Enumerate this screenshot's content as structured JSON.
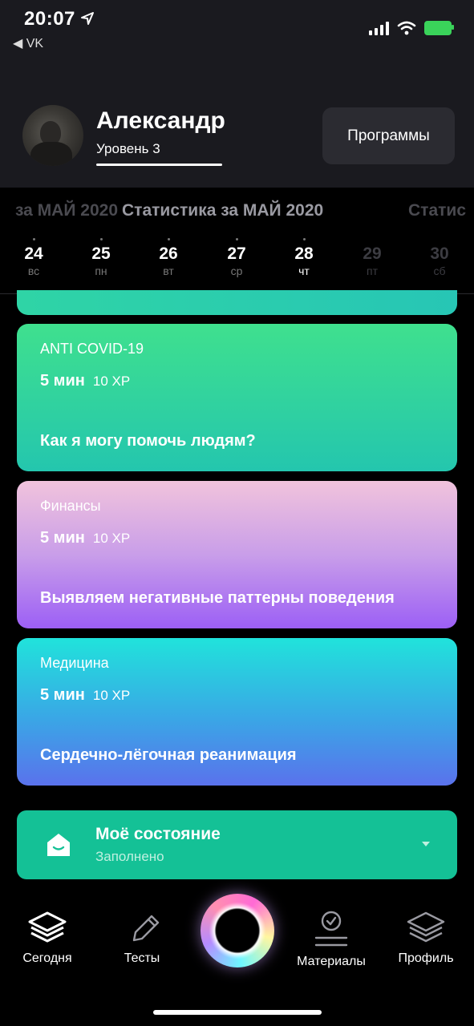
{
  "status_bar": {
    "time": "20:07",
    "back_app": "◀ VK",
    "icons": [
      "location-arrow-icon",
      "cellular-signal-icon",
      "wifi-icon",
      "battery-charging-icon"
    ]
  },
  "header": {
    "user_name": "Александр",
    "level": "Уровень 3",
    "programs_button": "Программы"
  },
  "stats": {
    "prev": "за МАЙ 2020",
    "current": "Статистика за МАЙ 2020",
    "next": "Статис"
  },
  "days": [
    {
      "num": "24",
      "weekday": "вс"
    },
    {
      "num": "25",
      "weekday": "пн"
    },
    {
      "num": "26",
      "weekday": "вт"
    },
    {
      "num": "27",
      "weekday": "ср"
    },
    {
      "num": "28",
      "weekday": "чт"
    },
    {
      "num": "29",
      "weekday": "пт"
    },
    {
      "num": "30",
      "weekday": "сб"
    }
  ],
  "cards": [
    {
      "category": "ANTI COVID-19",
      "minutes": "5 мин",
      "xp": "10 XP",
      "title": "Как я могу помочь людям?"
    },
    {
      "category": "Финансы",
      "minutes": "5 мин",
      "xp": "10 XP",
      "title": "Выявляем негативные паттерны поведения"
    },
    {
      "category": "Медицина",
      "minutes": "5 мин",
      "xp": "10 XP",
      "title": "Сердечно-лёгочная реанимация"
    }
  ],
  "state_panel": {
    "title": "Моё состояние",
    "subtitle": "Заполнено"
  },
  "tabbar": {
    "today": "Сегодня",
    "tests": "Тесты",
    "materials": "Материалы",
    "profile": "Профиль"
  },
  "colors": {
    "card_green": "#3fe08e",
    "card_purple": "#9c5ff5",
    "card_blue": "#3aa6e6",
    "state_panel": "#14c196"
  }
}
